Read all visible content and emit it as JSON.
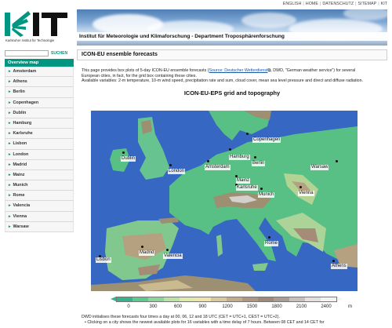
{
  "top_links": [
    "ENGLISH",
    "HOME",
    "DATENSCHUTZ",
    "SITEMAP",
    "KIT"
  ],
  "logo": {
    "text": "KIT",
    "subtitle": "Karlsruher Institut für Technologie"
  },
  "header": {
    "institute_title": "Institut für Meteorologie und Klimaforschung - Department Troposphärenforschung"
  },
  "search": {
    "placeholder": "",
    "button_label": "SUCHEN"
  },
  "sidebar": {
    "heading": "Overview map",
    "items": [
      {
        "label": "Amsterdam"
      },
      {
        "label": "Athens"
      },
      {
        "label": "Berlin"
      },
      {
        "label": "Copenhagen"
      },
      {
        "label": "Dublin"
      },
      {
        "label": "Hamburg"
      },
      {
        "label": "Karlsruhe"
      },
      {
        "label": "Lisbon"
      },
      {
        "label": "London"
      },
      {
        "label": "Madrid"
      },
      {
        "label": "Mainz"
      },
      {
        "label": "Munich"
      },
      {
        "label": "Rome"
      },
      {
        "label": "Valencia"
      },
      {
        "label": "Vienna"
      },
      {
        "label": "Warsaw"
      }
    ]
  },
  "main": {
    "title": "ICON-EU ensemble forecasts",
    "intro_1": "This page provides box plots of 5-day ICON-EU ensemble forecasts (",
    "intro_link": "Source: Deutscher Wetterdienst",
    "intro_2": ", DWD, \"German weather service\") for several European cities, in fact, for the grid box containing these cities.",
    "intro_3": "Available variables: 2-m temperature, 10-m wind speed, precipitation rate and sum, cloud cover, mean sea level pressure and direct and diffuse radiation.",
    "figure_title": "ICON-EU-EPS grid and topography",
    "footer_1": "DWD initialises these forecasts four times a day at 00, 06, 12 and 18 UTC (CET = UTC+1, CEST = UTC+2).",
    "footer_2": "• Clicking on a city shows the newest available plots for 16 variables with a time delay of 7 hours. Between 08 CET and 14 CET for"
  },
  "map": {
    "cities": [
      {
        "name": "Copenhagen"
      },
      {
        "name": "Dublin"
      },
      {
        "name": "Hamburg"
      },
      {
        "name": "Berlin"
      },
      {
        "name": "London"
      },
      {
        "name": "Amsterdam"
      },
      {
        "name": "Warsaw"
      },
      {
        "name": "Mainz"
      },
      {
        "name": "Karlsruhe"
      },
      {
        "name": "Munich"
      },
      {
        "name": "Vienna"
      },
      {
        "name": "Rome"
      },
      {
        "name": "Madrid"
      },
      {
        "name": "Valencia"
      },
      {
        "name": "Lisbon"
      },
      {
        "name": "Athens"
      }
    ],
    "colors": {
      "sea": "#3a6fd0",
      "lowland": "#5fcf8f",
      "hill": "#bfe3a0",
      "mountain": "#a89a7a",
      "peak": "#e8e6e0"
    }
  },
  "colorbar": {
    "ticks": [
      "0",
      "300",
      "600",
      "900",
      "1200",
      "1500",
      "1800",
      "2100",
      "2400"
    ],
    "unit": "m",
    "colors": [
      "#35b38a",
      "#5cc98f",
      "#8bd79a",
      "#b9e3a3",
      "#dfeaa8",
      "#efe3a8",
      "#dac89a",
      "#c3ac8a",
      "#b09780",
      "#9f8a7a",
      "#a89c95",
      "#c7c0bc",
      "#e3e0dd",
      "#f3f3f3"
    ]
  }
}
